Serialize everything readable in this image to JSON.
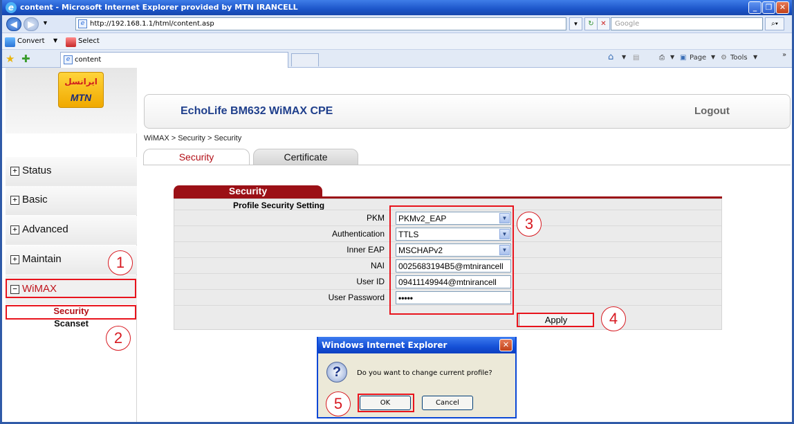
{
  "browser": {
    "title": "content - Microsoft Internet Explorer provided by MTN IRANCELL",
    "url": "http://192.168.1.1/html/content.asp",
    "search_placeholder": "Google",
    "toolbar": {
      "convert": "Convert",
      "select": "Select"
    },
    "tab_title": "content",
    "commands": {
      "page": "Page",
      "tools": "Tools"
    }
  },
  "logo": {
    "line1": "ایرانسل",
    "line2": "MTN"
  },
  "header": {
    "title": "EchoLife BM632 WiMAX CPE",
    "logout": "Logout"
  },
  "breadcrumb": "WiMAX > Security > Security",
  "tabs": [
    {
      "label": "Security",
      "active": true
    },
    {
      "label": "Certificate",
      "active": false
    }
  ],
  "sidebar": {
    "items": [
      {
        "label": "Status",
        "expanded": false
      },
      {
        "label": "Basic",
        "expanded": false
      },
      {
        "label": "Advanced",
        "expanded": false
      },
      {
        "label": "Maintain",
        "expanded": false
      },
      {
        "label": "WiMAX",
        "expanded": true
      }
    ],
    "subitems": [
      "Security",
      "Scanset"
    ]
  },
  "form": {
    "section_title": "Security",
    "subtitle": "Profile Security Setting",
    "rows": [
      {
        "label": "PKM",
        "value": "PKMv2_EAP",
        "type": "select"
      },
      {
        "label": "Authentication",
        "value": "TTLS",
        "type": "select"
      },
      {
        "label": "Inner EAP",
        "value": "MSCHAPv2",
        "type": "select"
      },
      {
        "label": "NAI",
        "value": "0025683194B5@mtnirancell",
        "type": "text"
      },
      {
        "label": "User ID",
        "value": "09411149944@mtnirancell",
        "type": "text"
      },
      {
        "label": "User Password",
        "value": "•••••",
        "type": "password"
      }
    ],
    "apply_label": "Apply"
  },
  "dialog": {
    "title": "Windows Internet Explorer",
    "message": "Do you want to change current profile?",
    "ok_label": "OK",
    "cancel_label": "Cancel"
  },
  "annotations": [
    "1",
    "2",
    "3",
    "4",
    "5"
  ],
  "colors": {
    "accent_red": "#9b1016",
    "annotation_red": "#e8131c",
    "title_blue": "#1f3f8c"
  }
}
